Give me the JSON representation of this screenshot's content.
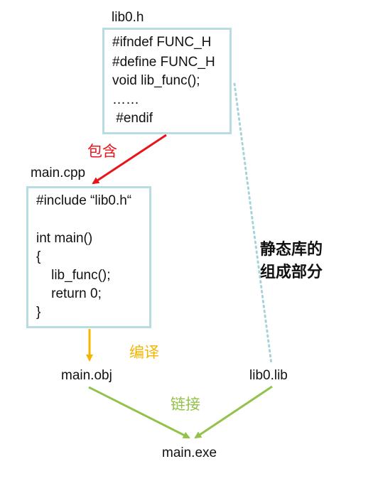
{
  "header_file": {
    "name": "lib0.h",
    "lines": [
      "#ifndef FUNC_H",
      "#define FUNC_H",
      "void lib_func();",
      "……",
      " #endif"
    ]
  },
  "source_file": {
    "name": "main.cpp",
    "lines": [
      "#include “lib0.h“",
      "",
      "int main()",
      "{",
      "    lib_func();",
      "    return 0;",
      "}"
    ]
  },
  "nodes": {
    "object_file": "main.obj",
    "library_file": "lib0.lib",
    "executable": "main.exe"
  },
  "edge_labels": {
    "include": "包含",
    "compile": "编译",
    "link": "链接"
  },
  "annotation": {
    "line1": "静态库的",
    "line2": "组成部分"
  },
  "colors": {
    "box_border": "#b7dde3",
    "include_arrow": "#e8141b",
    "compile_arrow": "#f5b400",
    "link_arrow": "#92c24a",
    "dotted_line": "#a6d2da"
  }
}
